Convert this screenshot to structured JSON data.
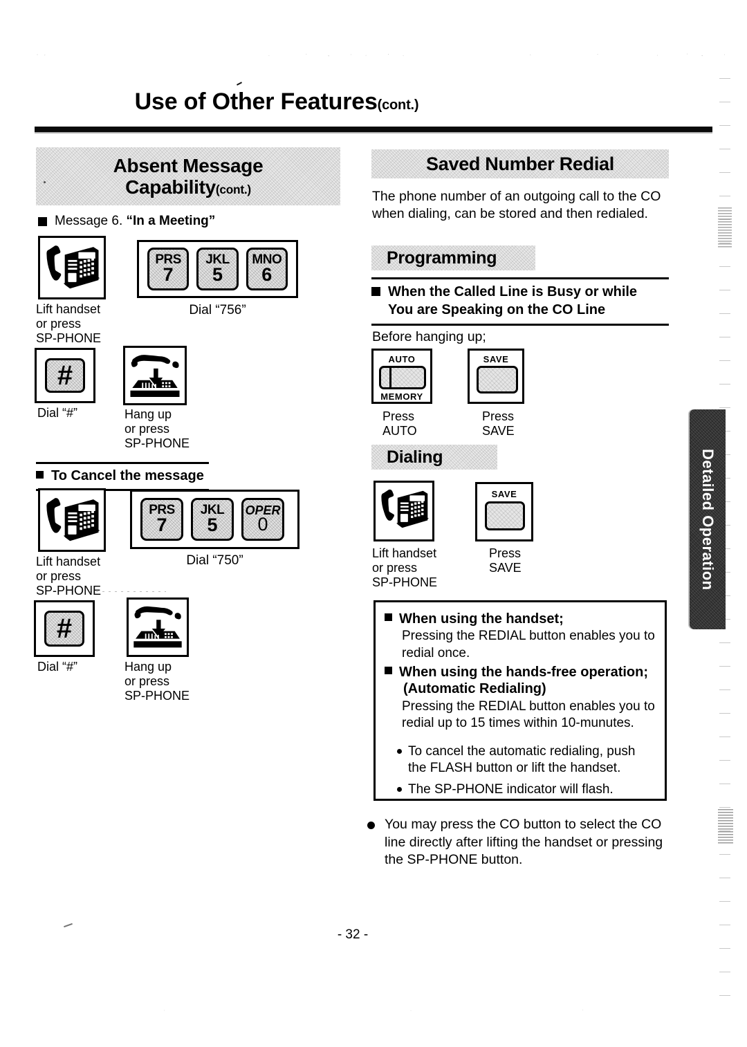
{
  "page": {
    "title": "Use of Other Features",
    "title_suffix": "(cont.)",
    "number": "- 32 -",
    "side_tab": "Detailed Operation"
  },
  "left_column": {
    "banner": {
      "line1": "Absent Message",
      "line2": "Capability",
      "suffix": "(cont.)"
    },
    "message6": {
      "prefix": "Message 6. ",
      "quoted": "“In a Meeting”"
    },
    "steps_set": {
      "lift_handset_caption": "Lift handset\nor press\nSP-PHONE",
      "dial_caption": "Dial “756”",
      "hash_caption": "Dial “#”",
      "hash_key": "#",
      "hangup_caption": "Hang up\nor press\nSP-PHONE",
      "keys": [
        {
          "letters": "PRS",
          "digit": "7"
        },
        {
          "letters": "JKL",
          "digit": "5"
        },
        {
          "letters": "MNO",
          "digit": "6"
        }
      ]
    },
    "cancel_heading": "To Cancel the message",
    "cancel_set": {
      "lift_handset_caption": "Lift handset\nor press\nSP-PHONE",
      "dial_caption": "Dial “750”",
      "hash_caption": "Dial “#”",
      "hash_key": "#",
      "hangup_caption": "Hang up\nor press\nSP-PHONE",
      "keys": [
        {
          "letters": "PRS",
          "digit": "7"
        },
        {
          "letters": "JKL",
          "digit": "5"
        },
        {
          "letters": "OPER",
          "digit": "0"
        }
      ]
    }
  },
  "right_column": {
    "banner": "Saved Number Redial",
    "intro": "The phone number of an outgoing call to the CO when dialing, can be stored and then redialed.",
    "programming_banner": "Programming",
    "busy_heading_line1": "When the Called Line is Busy or while",
    "busy_heading_line2": "You are Speaking on the CO Line",
    "before_hanging": "Before hanging up;",
    "auto_key": {
      "top_label": "AUTO",
      "bottom_label": "MEMORY",
      "caption": "Press\nAUTO"
    },
    "save_key": {
      "top_label": "SAVE",
      "caption": "Press\nSAVE"
    },
    "dialing_banner": "Dialing",
    "dialing_lift_caption": "Lift handset\nor press\nSP-PHONE",
    "dialing_save_key_label": "SAVE",
    "dialing_save_caption": "Press\nSAVE",
    "note_box": {
      "handset_heading": "When using the handset;",
      "handset_body": "Pressing the REDIAL button enables you to redial once.",
      "handsfree_heading": "When using the hands-free operation;",
      "handsfree_subheading": "(Automatic Redialing)",
      "handsfree_body": "Pressing the REDIAL button enables you to redial up to 15 times within 10-munutes.",
      "bullets": [
        "To cancel the automatic redialing, push the FLASH button or lift the handset.",
        "The SP-PHONE indicator will flash."
      ]
    },
    "bottom_bullet": "You may press the CO button to select the CO line directly after lifting the handset or pressing the SP-PHONE button."
  },
  "colors": {
    "ink": "#000000",
    "paper": "#ffffff",
    "banner_fill": "#e9e9e9",
    "key_fill": "#e4e4e4",
    "tab_fill": "#2c2c2c"
  }
}
